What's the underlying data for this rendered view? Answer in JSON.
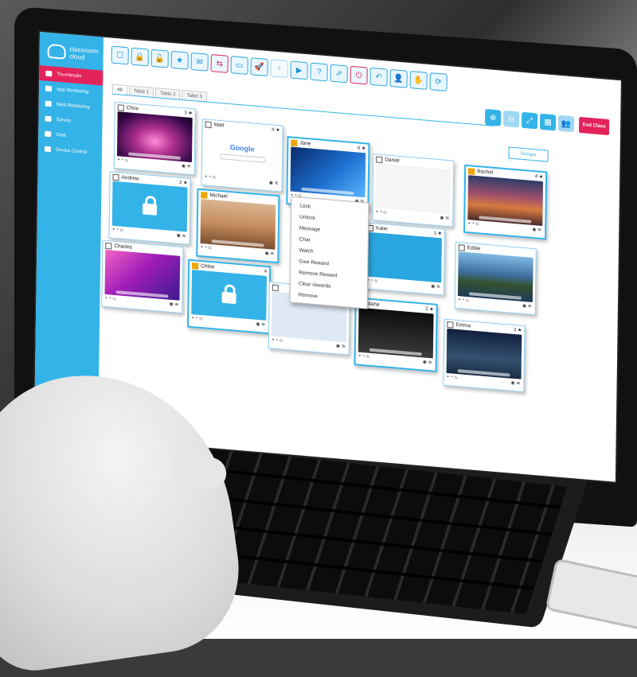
{
  "app": {
    "logo_line1": "classroom",
    "logo_line2": "cloud"
  },
  "sidebar": {
    "items": [
      {
        "label": "Thumbnails",
        "active": true
      },
      {
        "label": "App Monitoring",
        "active": false
      },
      {
        "label": "Web Monitoring",
        "active": false
      },
      {
        "label": "Survey",
        "active": false
      },
      {
        "label": "Chat",
        "active": false
      },
      {
        "label": "Device Control",
        "active": false
      }
    ]
  },
  "toolbar": {
    "icons": [
      "select-icon",
      "lock-icon",
      "unlock-icon",
      "star-icon",
      "message-icon",
      "link-icon",
      "screen-icon",
      "launch-icon",
      "snap-icon",
      "play-icon",
      "help-icon",
      "share-icon",
      "power-icon",
      "undo-icon",
      "user-icon",
      "hand-icon",
      "refresh-icon"
    ],
    "glyphs": [
      "☐",
      "🔒",
      "🔓",
      "★",
      "✉",
      "⇆",
      "▭",
      "🚀",
      "⌖",
      "▶",
      "?",
      "⇗",
      "⏻",
      "↶",
      "👤",
      "✋",
      "⟳"
    ],
    "right_glyphs": [
      "⊕",
      "⊖",
      "⤢",
      "▦",
      "👥"
    ],
    "end_class": "End Class"
  },
  "tabs": [
    "All",
    "Table 1",
    "Table 2",
    "Table 3"
  ],
  "groups_button": "Groups",
  "students": [
    {
      "name": "Chris",
      "checked": false,
      "badge": "3 ★",
      "theme": "pink"
    },
    {
      "name": "Matt",
      "checked": false,
      "badge": "4 ★",
      "theme": "google"
    },
    {
      "name": "Jane",
      "checked": true,
      "badge": "6 ★",
      "theme": "win"
    },
    {
      "name": "Daniel",
      "checked": false,
      "badge": "",
      "theme": "class"
    },
    {
      "name": "Rachel",
      "checked": true,
      "badge": "4 ★",
      "theme": "mojave-red"
    },
    {
      "name": "Andrew",
      "checked": false,
      "badge": "2 ★",
      "theme": "lock"
    },
    {
      "name": "Michael",
      "checked": true,
      "badge": "",
      "theme": "desert"
    },
    {
      "name": "Katie",
      "checked": false,
      "badge": "1 ★",
      "theme": "blue"
    },
    {
      "name": "Eddie",
      "checked": false,
      "badge": "",
      "theme": "catalina"
    },
    {
      "name": "Charles",
      "checked": false,
      "badge": "",
      "theme": "magenta"
    },
    {
      "name": "Chloe",
      "checked": true,
      "badge": "4",
      "theme": "lock"
    },
    {
      "name": "",
      "checked": false,
      "badge": "",
      "theme": "web"
    },
    {
      "name": "Asha",
      "checked": true,
      "badge": "2 ★",
      "theme": "photo"
    },
    {
      "name": "Emma",
      "checked": false,
      "badge": "3 ★",
      "theme": "night"
    }
  ],
  "thumb_texts": {
    "google": "Google"
  },
  "context_menu": [
    "Lock",
    "Unlock",
    "Message",
    "Chat",
    "Watch",
    "Give Reward",
    "Remove Reward",
    "Clear rewards",
    "Remove"
  ]
}
